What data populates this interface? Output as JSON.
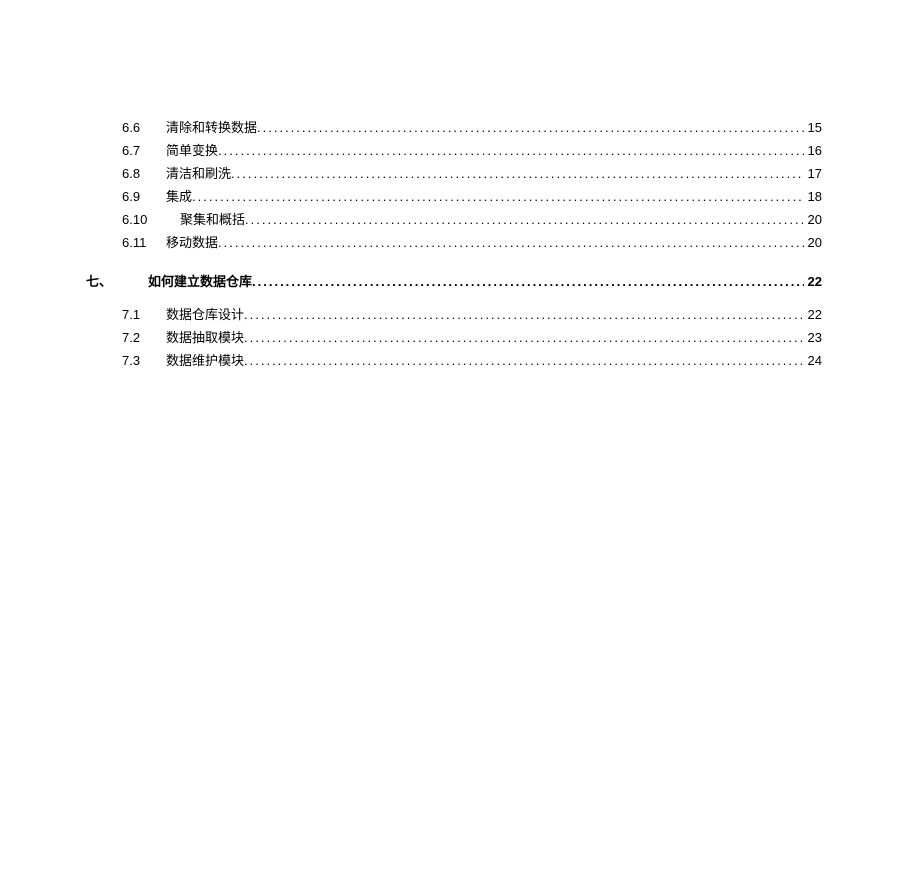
{
  "items": [
    {
      "num": "6.6",
      "title": "清除和转换数据",
      "page": "15",
      "type": "sub"
    },
    {
      "num": "6.7",
      "title": "简单变换",
      "page": "16",
      "type": "sub"
    },
    {
      "num": "6.8",
      "title": "清洁和刷洗",
      "page": "17",
      "type": "sub"
    },
    {
      "num": "6.9",
      "title": "集成",
      "page": "18",
      "type": "sub"
    },
    {
      "num": "6.10",
      "title": "聚集和概括",
      "page": "20",
      "type": "sub-indent"
    },
    {
      "num": "6.11",
      "title": "移动数据",
      "page": "20",
      "type": "sub-wide"
    },
    {
      "num": "七、",
      "title": "如何建立数据仓库",
      "page": "22",
      "type": "section"
    },
    {
      "num": "7.1",
      "title": "数据仓库设计",
      "page": "22",
      "type": "sub"
    },
    {
      "num": "7.2",
      "title": "数据抽取模块",
      "page": "23",
      "type": "sub"
    },
    {
      "num": "7.3",
      "title": "数据维护模块",
      "page": "24",
      "type": "sub"
    }
  ]
}
